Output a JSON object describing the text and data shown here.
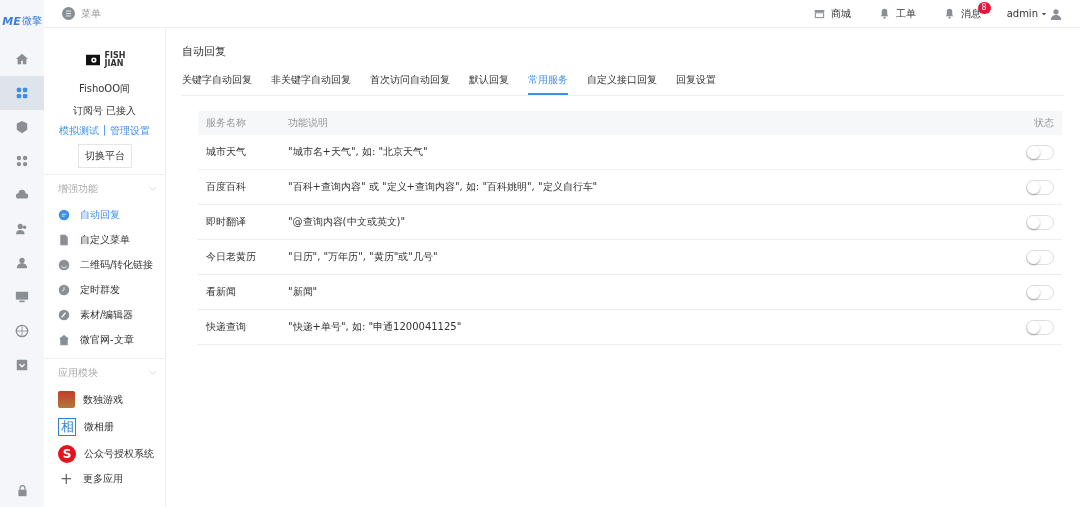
{
  "brand": {
    "mark": "ME",
    "name": "微擎"
  },
  "rail": [
    {
      "selected": false
    },
    {
      "selected": true
    },
    {
      "selected": false
    },
    {
      "selected": false
    },
    {
      "selected": false
    },
    {
      "selected": false
    },
    {
      "selected": false
    },
    {
      "selected": false
    },
    {
      "selected": false
    },
    {
      "selected": false
    }
  ],
  "topbar": {
    "menu_label": "菜单",
    "links": [
      {
        "label": "商城"
      },
      {
        "label": "工单"
      },
      {
        "label": "消息",
        "badge": "8"
      }
    ],
    "user": "admin"
  },
  "account": {
    "logo_lines": [
      "FISH",
      "JIAN"
    ],
    "name": "FishoOO间",
    "status": "订阅号 已接入",
    "links": [
      "模拟测试",
      "管理设置"
    ],
    "separator": "|",
    "switch_button": "切换平台"
  },
  "sections": [
    {
      "title": "增强功能",
      "items": [
        {
          "label": "自动回复",
          "selected": true
        },
        {
          "label": "自定义菜单",
          "selected": false
        },
        {
          "label": "二维码/转化链接",
          "selected": false
        },
        {
          "label": "定时群发",
          "selected": false
        },
        {
          "label": "素材/编辑器",
          "selected": false
        },
        {
          "label": "微官网-文章",
          "selected": false
        }
      ]
    },
    {
      "title": "应用模块",
      "items": [
        {
          "label": "数独游戏",
          "kind": "tile"
        },
        {
          "label": "微相册",
          "kind": "char",
          "mark": "相"
        },
        {
          "label": "公众号授权系统",
          "kind": "circle",
          "mark": "S"
        }
      ]
    }
  ],
  "more_apps": {
    "mark": "+",
    "label": "更多应用"
  },
  "page_title": "自动回复",
  "tabs": [
    {
      "label": "关键字自动回复",
      "selected": false
    },
    {
      "label": "非关键字自动回复",
      "selected": false
    },
    {
      "label": "首次访问自动回复",
      "selected": false
    },
    {
      "label": "默认回复",
      "selected": false
    },
    {
      "label": "常用服务",
      "selected": true
    },
    {
      "label": "自定义接口回复",
      "selected": false
    },
    {
      "label": "回复设置",
      "selected": false
    }
  ],
  "table": {
    "columns": [
      "服务名称",
      "功能说明",
      "状态"
    ],
    "rows": [
      {
        "name": "城市天气",
        "description": "\"城市名+天气\", 如: \"北京天气\"",
        "on": false
      },
      {
        "name": "百度百科",
        "description": "\"百科+查询内容\" 或 \"定义+查询内容\", 如: \"百科姚明\", \"定义自行车\"",
        "on": false
      },
      {
        "name": "即时翻译",
        "description": "\"@查询内容(中文或英文)\"",
        "on": false
      },
      {
        "name": "今日老黄历",
        "description": "\"日历\", \"万年历\", \"黄历\"或\"几号\"",
        "on": false
      },
      {
        "name": "看新闻",
        "description": "\"新闻\"",
        "on": false
      },
      {
        "name": "快递查询",
        "description": "\"快递+单号\", 如: \"申通1200041125\"",
        "on": false
      }
    ]
  }
}
